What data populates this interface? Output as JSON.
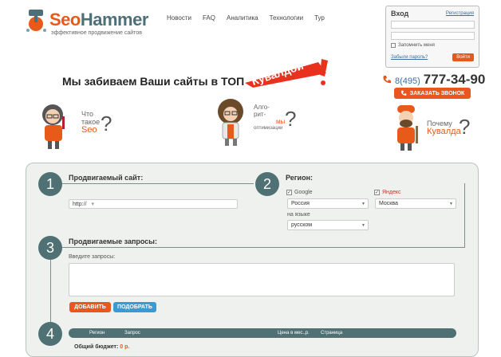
{
  "brand": {
    "name_a": "Seo",
    "name_b": "Hammer",
    "tagline": "эффективное продвижение сайтов"
  },
  "nav": [
    "Новости",
    "FAQ",
    "Аналитика",
    "Технологии",
    "Тур"
  ],
  "login": {
    "title": "Вход",
    "register": "Регистрация",
    "remember": "Запомнить меня",
    "forgot": "Забыли пароль?",
    "enter": "Войти"
  },
  "promo": {
    "slogan": "Мы забиваем Ваши сайты в ТОП",
    "sticker": "Кувалдой"
  },
  "contact": {
    "phone_code": "8(495)",
    "phone_number": "777-34-90",
    "call_button": "ЗАКАЗАТЬ ЗВОНОК"
  },
  "characters": {
    "seo_line1": "Что",
    "seo_line2": "такое",
    "seo_line3": "Seo",
    "algo_line1": "Алго-",
    "algo_line2": "рит-",
    "algo_line3": "мы",
    "algo_line4": "оптимизации",
    "hammer_line1": "Почему",
    "hammer_line2": "Кувалда"
  },
  "form": {
    "step1": "1",
    "step2": "2",
    "step3": "3",
    "step4": "4",
    "site_title": "Продвигаемый сайт:",
    "site_value": "http://",
    "region_title": "Регион:",
    "google_label": "Google",
    "yandex_label": "Яндекс",
    "google_region": "Россия",
    "yandex_region": "Москва",
    "language_label": "на языке",
    "language_value": "русском",
    "queries_title": "Продвигаемые запросы:",
    "queries_label": "Введите запросы:",
    "add_button": "ДОБАВИТЬ",
    "pick_button": "ПОДОБРАТЬ",
    "table_headers": [
      "Регион",
      "Запрос",
      "Цена в мес.,р.",
      "Страница"
    ],
    "budget_label": "Общий бюджет:",
    "budget_value": "0 р."
  },
  "colors": {
    "accent": "#e8581e",
    "teal": "#4f7174",
    "link": "#3a6ea5"
  }
}
